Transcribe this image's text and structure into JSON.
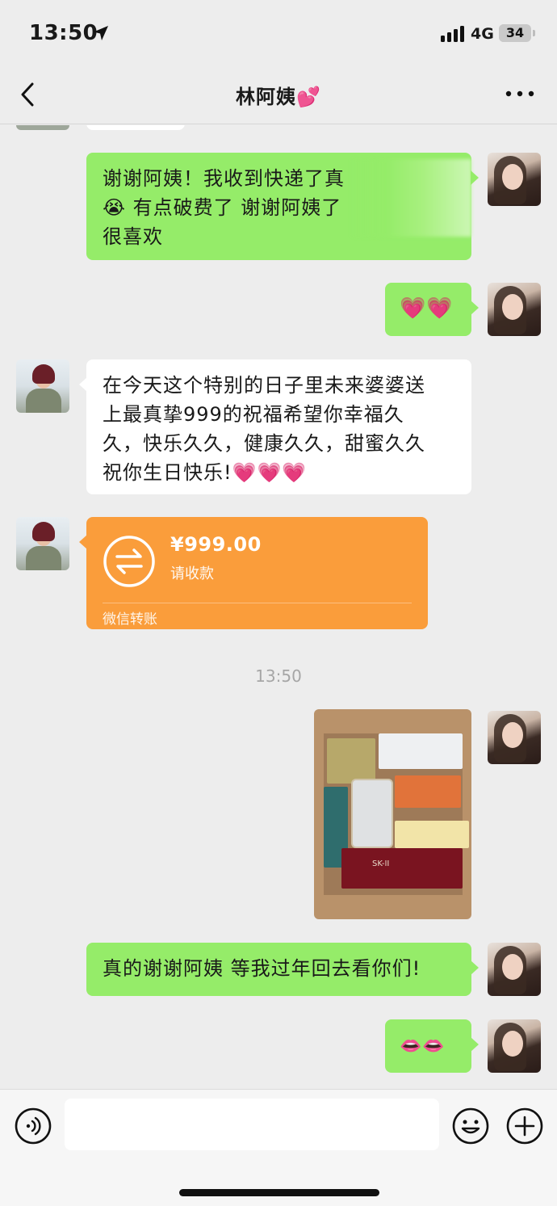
{
  "status_bar": {
    "time": "13:50",
    "network": "4G",
    "battery_level": "34",
    "battery_fraction": 0.34
  },
  "nav": {
    "title": "林阿姨💕"
  },
  "messages": [
    {
      "sender": "self",
      "type": "text",
      "text_lines": [
        "谢谢阿姨！我收到快递了真",
        "😭 有点破费了 谢谢阿姨了",
        "很喜欢"
      ]
    },
    {
      "sender": "self",
      "type": "text",
      "text": "💗💗"
    },
    {
      "sender": "aunt",
      "type": "text",
      "text_lines": [
        "在今天这个特别的日子里未来婆婆送",
        "上最真挚999的祝福希望你幸福久",
        "久，快乐久久，健康久久，甜蜜久久",
        " 祝你生日快乐!💗💗💗"
      ]
    },
    {
      "sender": "aunt",
      "type": "transfer",
      "amount": "¥999.00",
      "status": "请收款",
      "source": "微信转账"
    },
    {
      "sender": "self",
      "type": "image"
    },
    {
      "sender": "self",
      "type": "text",
      "text": "真的谢谢阿姨 等我过年回去看你们!"
    },
    {
      "sender": "self",
      "type": "text",
      "text": "👄👄"
    }
  ],
  "timestamp": "13:50",
  "photo_items": {
    "phone_label": "",
    "box_label": "SK-II"
  },
  "input": {
    "value": "",
    "placeholder": ""
  },
  "icons": {
    "back": "chevron-left-icon",
    "more": "more-dots-icon",
    "voice": "voice-icon",
    "emoji": "emoji-icon",
    "plus": "plus-icon",
    "transfer": "transfer-arrows-icon"
  },
  "colors": {
    "self_bubble": "#95ec69",
    "other_bubble": "#ffffff",
    "transfer_card": "#fa9d3b",
    "background": "#ededed"
  }
}
